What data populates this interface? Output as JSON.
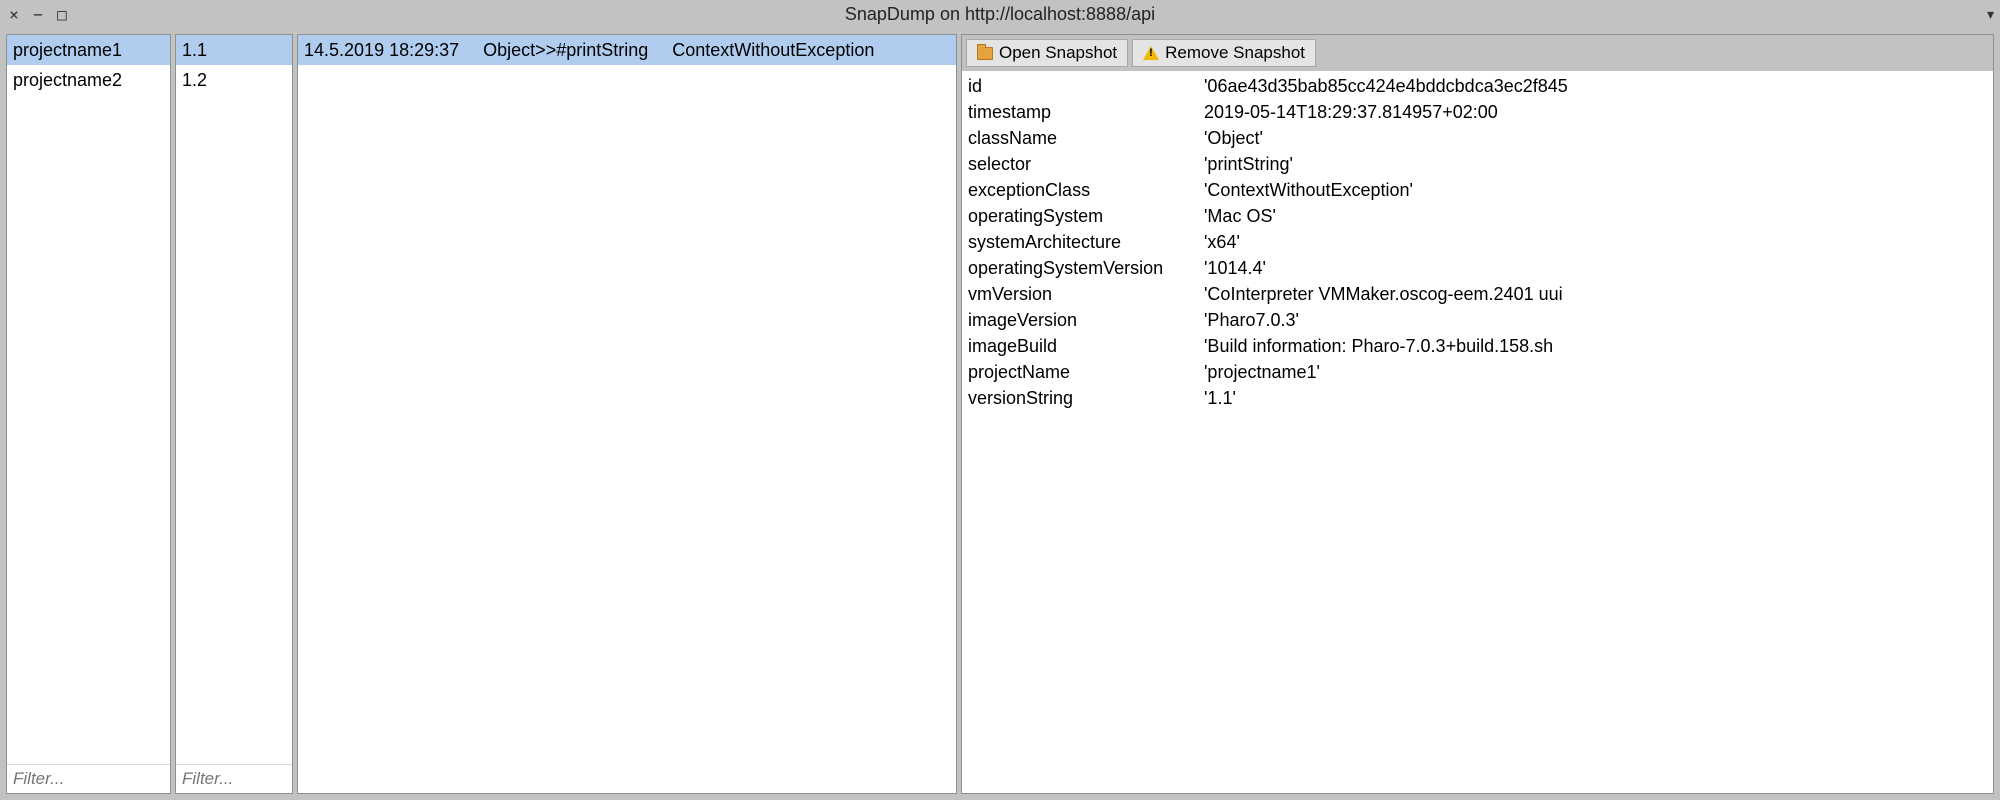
{
  "window": {
    "title": "SnapDump on http://localhost:8888/api"
  },
  "projects": {
    "items": [
      "projectname1",
      "projectname2"
    ],
    "selected": 0,
    "filter_placeholder": "Filter..."
  },
  "versions": {
    "items": [
      "1.1",
      "1.2"
    ],
    "selected": 0,
    "filter_placeholder": "Filter..."
  },
  "snapshots": {
    "items": [
      {
        "timestamp": "14.5.2019 18:29:37",
        "method": "Object>>#printString",
        "exception": "ContextWithoutException"
      }
    ],
    "selected": 0
  },
  "toolbar": {
    "open_label": "Open Snapshot",
    "remove_label": "Remove Snapshot"
  },
  "details": {
    "rows": [
      {
        "key": "id",
        "value": "'06ae43d35bab85cc424e4bddcbdca3ec2f845"
      },
      {
        "key": "timestamp",
        "value": "2019-05-14T18:29:37.814957+02:00"
      },
      {
        "key": "className",
        "value": "'Object'"
      },
      {
        "key": "selector",
        "value": "'printString'"
      },
      {
        "key": "exceptionClass",
        "value": "'ContextWithoutException'"
      },
      {
        "key": "operatingSystem",
        "value": "'Mac OS'"
      },
      {
        "key": "systemArchitecture",
        "value": "'x64'"
      },
      {
        "key": "operatingSystemVersion",
        "value": "'1014.4'"
      },
      {
        "key": "vmVersion",
        "value": "'CoInterpreter VMMaker.oscog-eem.2401 uui"
      },
      {
        "key": "imageVersion",
        "value": "'Pharo7.0.3'"
      },
      {
        "key": "imageBuild",
        "value": "'Build information: Pharo-7.0.3+build.158.sh"
      },
      {
        "key": "projectName",
        "value": "'projectname1'"
      },
      {
        "key": "versionString",
        "value": "'1.1'"
      }
    ]
  }
}
